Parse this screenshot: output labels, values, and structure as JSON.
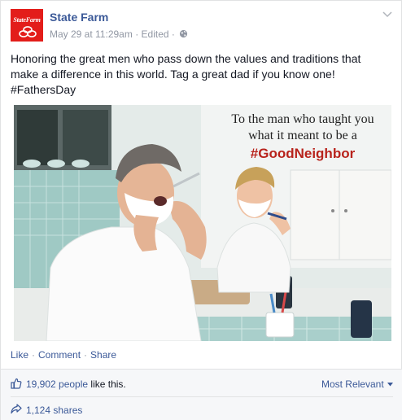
{
  "post": {
    "page_name": "State Farm",
    "logo_text": "StateFarm",
    "timestamp": "May 29 at 11:29am",
    "edited_label": "Edited",
    "separator": "·",
    "privacy_icon": "globe-icon",
    "menu_icon": "chevron-down-icon",
    "message_line1": "Honoring the great men who pass down the values and traditions that",
    "message_line2": "make a difference in this world. Tag a great dad if you know one!",
    "message_line3": "#FathersDay",
    "photo": {
      "caption_line1": "To the man who taught you",
      "caption_line2": "what it meant to be a",
      "caption_tag": "#GoodNeighbor"
    }
  },
  "actions": {
    "like": "Like",
    "comment": "Comment",
    "share": "Share",
    "separator": "·"
  },
  "feedback": {
    "likes_count": "19,902 people",
    "likes_suffix": " like this.",
    "sort_label": "Most Relevant",
    "sort_icon": "caret-down-icon",
    "shares": "1,124 shares"
  },
  "colors": {
    "brand_red": "#e31d1a",
    "link_blue": "#3b5998",
    "meta_gray": "#9197a3",
    "hashtag_red": "#b8231c"
  }
}
